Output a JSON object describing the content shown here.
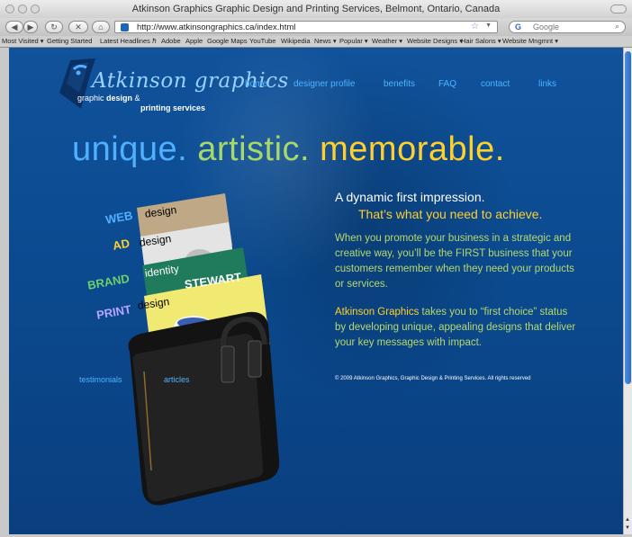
{
  "window": {
    "title": "Atkinson Graphics Graphic Design and Printing Services, Belmont, Ontario, Canada"
  },
  "toolbar": {
    "url": "http://www.atkinsongraphics.ca/index.html",
    "search_placeholder": "Google",
    "search_engine_letter": "G"
  },
  "bookmarks": [
    "Most Visited ▾",
    "Getting Started",
    "Latest Headlines ℏ",
    "Adobe",
    "Apple",
    "Google Maps",
    "YouTube",
    "Wikipedia",
    "News ▾",
    "Popular ▾",
    "Weather ▾",
    "Website Designs ▾",
    "Hair Salons ▾",
    "Website Mngmnt ▾"
  ],
  "site": {
    "logo": {
      "name": "Atkinson graphics",
      "line1_a": "graphic ",
      "line1_b": "design",
      "line1_c": " &",
      "line2": "printing services"
    },
    "nav": [
      "home",
      "designer profile",
      "benefits",
      "FAQ",
      "contact",
      "links"
    ],
    "headline": {
      "w1": "unique.",
      "w2": " artistic.",
      "w3": " memorable."
    },
    "lead1": "A dynamic first impression.",
    "lead2": "That’s what you need to achieve.",
    "para1": "When you promote your business in a strategic and creative way, you’ll be the FIRST business that your customers remember when they need your products or services.",
    "para2_highlight": "Atkinson Graphics",
    "para2_rest": " takes you to “first choice” status by developing unique, appealing designs that deliver your key messages with impact.",
    "copyright": "© 2009 Atkinson Graphics, Graphic Design & Printing Services. All rights reserved",
    "portfolio": [
      {
        "label": "WEB",
        "word": "design",
        "color": "#4fb0ff"
      },
      {
        "label": "AD",
        "word": "design",
        "color": "#ffcf2e"
      },
      {
        "label": "BRAND",
        "word": "identity",
        "color": "#6fcf6a"
      },
      {
        "label": "PRINT",
        "word": "design",
        "color": "#b9a6ff"
      }
    ],
    "sheet_brand": "STEWART",
    "testimonials": "testimonials",
    "articles": "articles"
  },
  "colors": {
    "page_bg": "#0b4a8f",
    "link": "#4fb3ff",
    "accent_yellow": "#ffcf2e",
    "accent_green": "#b6d96f"
  }
}
